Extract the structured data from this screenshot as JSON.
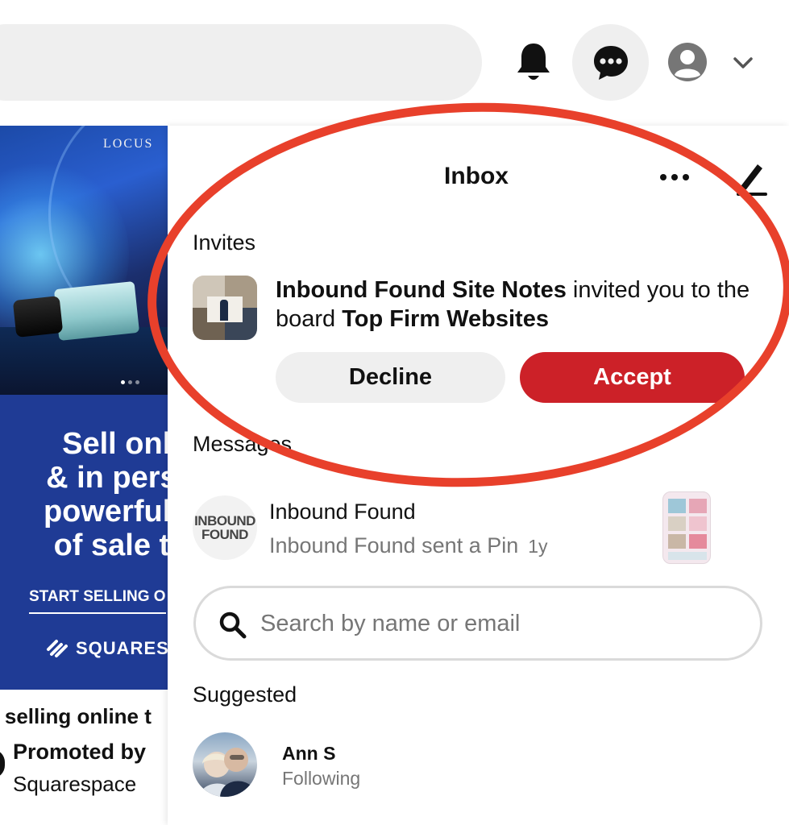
{
  "header": {
    "notifications_icon": "bell-icon",
    "messages_icon": "speech-bubble-dots-icon",
    "profile_icon": "user-avatar-icon",
    "account_menu_icon": "chevron-down-icon"
  },
  "ad": {
    "brand": "LOCUS",
    "headline": "Sell onli\n& in perso\npowerful p\nof sale to",
    "cta": "START SELLING O",
    "logo": "SQUARES",
    "title": "t selling online t",
    "promoted_line1": "Promoted by",
    "promoted_line2": "Squarespace"
  },
  "inbox": {
    "title": "Inbox",
    "more_icon": "more-dots-icon",
    "compose_icon": "pencil-icon",
    "invites_label": "Invites",
    "invite": {
      "inviter": "Inbound Found Site Notes",
      "text1": " invited you to the board ",
      "board": "Top Firm Websites",
      "decline": "Decline",
      "accept": "Accept"
    },
    "messages_label": "Messages",
    "conversation": {
      "avatar_line1": "INBOUND",
      "avatar_line2": "FOUND",
      "name": "Inbound Found",
      "preview": "Inbound Found sent a Pin",
      "time": "1y"
    },
    "search": {
      "placeholder": "Search by name or email",
      "value": ""
    },
    "suggested_label": "Suggested",
    "suggested": [
      {
        "name": "Ann S",
        "status": "Following"
      }
    ]
  },
  "colors": {
    "accept": "#cc2128",
    "annotation": "#e8402b",
    "muted_text": "#767676",
    "ad_blue": "#1f3b95"
  }
}
